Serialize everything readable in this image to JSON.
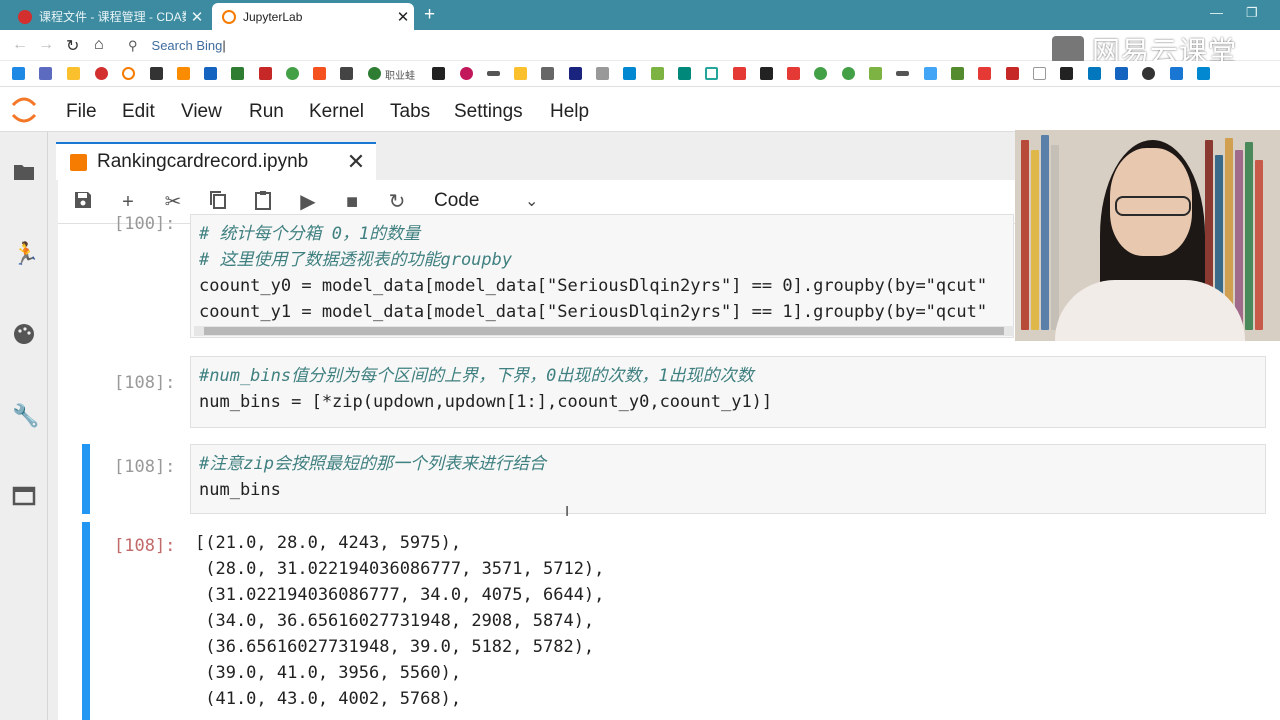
{
  "browser": {
    "tabs": [
      {
        "label": "课程文件 - 课程管理 - CDA数据",
        "active": false,
        "favicon": "cda-favicon"
      },
      {
        "label": "JupyterLab",
        "active": true,
        "favicon": "jupyter-favicon"
      }
    ],
    "address_placeholder": "Search Bing"
  },
  "watermark": "网易云课堂",
  "bookmarks_text": "职业蛙",
  "menu": [
    "File",
    "Edit",
    "View",
    "Run",
    "Kernel",
    "Tabs",
    "Settings",
    "Help"
  ],
  "notebook": {
    "tab_name": "Rankingcardrecord.ipynb",
    "cell_type": "Code",
    "cells": [
      {
        "prompt": "[100]:",
        "lines": [
          "# 统计每个分箱 0，1的数量",
          "# 这里使用了数据透视表的功能groupby",
          "coount_y0 = model_data[model_data[\"SeriousDlqin2yrs\"] == 0].groupby(by=\"qcut\"",
          "coount_y1 = model_data[model_data[\"SeriousDlqin2yrs\"] == 1].groupby(by=\"qcut\""
        ]
      },
      {
        "prompt": "[108]:",
        "lines": [
          "#num_bins值分别为每个区间的上界，下界，0出现的次数，1出现的次数",
          "num_bins = [*zip(updown,updown[1:],coount_y0,coount_y1)]"
        ]
      },
      {
        "prompt": "[108]:",
        "lines": [
          "#注意zip会按照最短的那一个列表来进行结合",
          "num_bins"
        ]
      },
      {
        "prompt": "[108]:",
        "output": [
          "[(21.0, 28.0, 4243, 5975),",
          " (28.0, 31.022194036086777, 3571, 5712),",
          " (31.022194036086777, 34.0, 4075, 6644),",
          " (34.0, 36.65616027731948, 2908, 5874),",
          " (36.65616027731948, 39.0, 5182, 5782),",
          " (39.0, 41.0, 3956, 5560),",
          " (41.0, 43.0, 4002, 5768),"
        ]
      }
    ]
  }
}
